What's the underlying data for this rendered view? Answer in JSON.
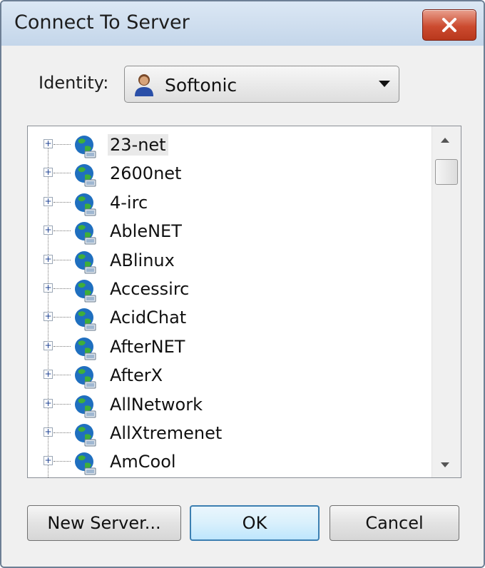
{
  "window": {
    "title": "Connect To Server"
  },
  "identity": {
    "label": "Identity:",
    "value": "Softonic"
  },
  "servers": [
    {
      "name": "23-net",
      "selected": true
    },
    {
      "name": "2600net"
    },
    {
      "name": "4-irc"
    },
    {
      "name": "AbleNET"
    },
    {
      "name": "ABlinux"
    },
    {
      "name": "Accessirc"
    },
    {
      "name": "AcidChat"
    },
    {
      "name": "AfterNET"
    },
    {
      "name": "AfterX"
    },
    {
      "name": "AllNetwork"
    },
    {
      "name": "AllXtremenet"
    },
    {
      "name": "AmCool"
    }
  ],
  "buttons": {
    "new_server": "New Server...",
    "ok": "OK",
    "cancel": "Cancel"
  },
  "icons": {
    "close": "close-icon",
    "identity": "user-avatar-icon",
    "server": "globe-icon",
    "expander": "plus-expander-icon"
  },
  "colors": {
    "titlebar": "#c4d6ea",
    "close_button": "#cc4b2f",
    "ok_border": "#3c7fb1"
  }
}
